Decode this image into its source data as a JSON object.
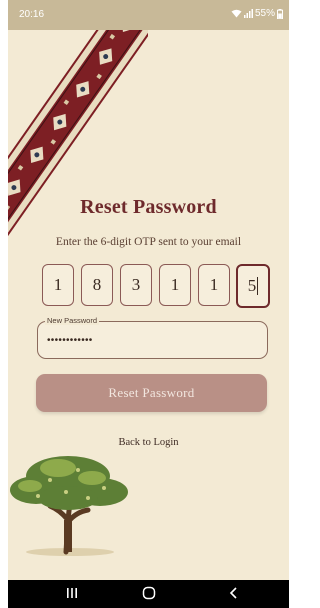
{
  "status_bar": {
    "time": "20:16",
    "battery": "55%"
  },
  "screen": {
    "title": "Reset Password",
    "subtitle": "Enter the 6-digit OTP sent to your email"
  },
  "otp": {
    "digits": [
      "1",
      "8",
      "3",
      "1",
      "1",
      "5"
    ],
    "active_index": 5
  },
  "new_password": {
    "label": "New Password",
    "value": "••••••••••••"
  },
  "reset_button": {
    "label": "Reset Password"
  },
  "back_link": {
    "label": "Back to Login"
  },
  "colors": {
    "background": "#f3ead4",
    "title": "#6e2a2c",
    "button": "#b99086",
    "otp_border": "#8b5a56"
  },
  "icons": {
    "wifi": "wifi-icon",
    "signal": "signal-icon",
    "battery": "battery-icon",
    "nav_recent": "recent-apps-icon",
    "nav_home": "home-icon",
    "nav_back": "back-icon"
  }
}
